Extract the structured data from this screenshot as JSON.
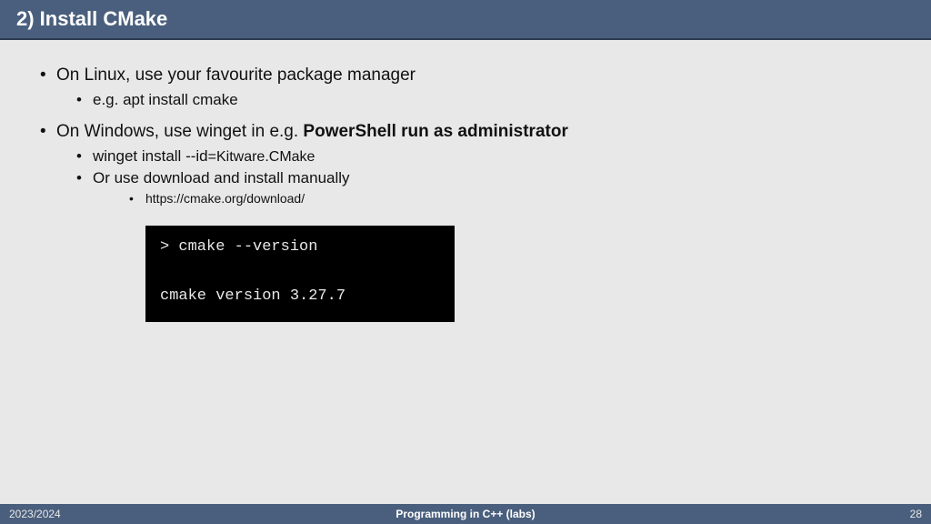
{
  "header": {
    "title": "2) Install CMake"
  },
  "bullets": {
    "b1": "On Linux, use your favourite package manager",
    "b1_1": "e.g. apt install cmake",
    "b2_pre": "On Windows, use winget in e.g. ",
    "b2_bold": "PowerShell run as administrator",
    "b2_1_pre": "winget install ",
    "b2_1_flag": "--id",
    "b2_1_rest": "=Kitware.CMake",
    "b2_2": "Or use download and install manually",
    "b2_2_1": "https://cmake.org/download/"
  },
  "terminal": {
    "line1": "> cmake --version",
    "line2": "",
    "line3": "cmake version 3.27.7"
  },
  "footer": {
    "left": "2023/2024",
    "center": "Programming in C++ (labs)",
    "right": "28"
  }
}
